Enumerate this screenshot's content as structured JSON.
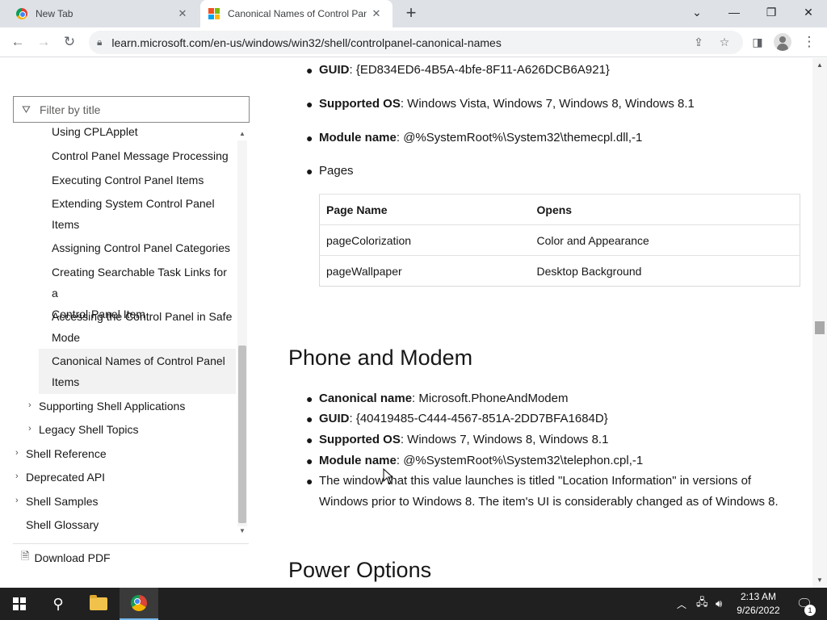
{
  "browser": {
    "tabs": [
      {
        "title": "New Tab"
      },
      {
        "title": "Canonical Names of Control Panel Items"
      }
    ],
    "url": "learn.microsoft.com/en-us/windows/win32/shell/controlpanel-canonical-names"
  },
  "nav": {
    "filter_placeholder": "Filter by title",
    "items": [
      {
        "label": "Using CPLApplet"
      },
      {
        "label": "Control Panel Message Processing"
      },
      {
        "label": "Executing Control Panel Items"
      },
      {
        "label": "Extending System Control Panel",
        "label2": "Items"
      },
      {
        "label": "Assigning Control Panel Categories"
      },
      {
        "label": "Creating Searchable Task Links for a",
        "label2": "Control Panel Item"
      },
      {
        "label": "Accessing the Control Panel in Safe",
        "label2": "Mode"
      },
      {
        "label": "Canonical Names of Control Panel",
        "label2": "Items"
      },
      {
        "label": "Supporting Shell Applications"
      },
      {
        "label": "Legacy Shell Topics"
      },
      {
        "label": "Shell Reference"
      },
      {
        "label": "Deprecated API"
      },
      {
        "label": "Shell Samples"
      },
      {
        "label": "Shell Glossary"
      }
    ],
    "download_label": "Download PDF"
  },
  "content": {
    "personalization": {
      "guid_label": "GUID",
      "guid": ": {ED834ED6-4B5A-4bfe-8F11-A626DCB6A921}",
      "os_label": "Supported OS",
      "os": ": Windows Vista, Windows 7, Windows 8, Windows 8.1",
      "module_label": "Module name",
      "module": ": @%SystemRoot%\\System32\\themecpl.dll,-1",
      "pages_label": "Pages",
      "table": {
        "headers": [
          "Page Name",
          "Opens"
        ],
        "rows": [
          [
            "pageColorization",
            "Color and Appearance"
          ],
          [
            "pageWallpaper",
            "Desktop Background"
          ]
        ]
      }
    },
    "phone": {
      "heading": "Phone and Modem",
      "canonical_label": "Canonical name",
      "canonical": ": Microsoft.PhoneAndModem",
      "guid_label": "GUID",
      "guid": ": {40419485-C444-4567-851A-2DD7BFA1684D}",
      "os_label": "Supported OS",
      "os": ": Windows 7, Windows 8, Windows 8.1",
      "module_label": "Module name",
      "module": ": @%SystemRoot%\\System32\\telephon.cpl,-1",
      "note": "The window that this value launches is titled \"Location Information\" in versions of Windows prior to Windows 8. The item's UI is considerably changed as of Windows 8."
    },
    "power": {
      "heading": "Power Options"
    }
  },
  "taskbar": {
    "time": "2:13 AM",
    "date": "9/26/2022",
    "notification_count": "1"
  }
}
